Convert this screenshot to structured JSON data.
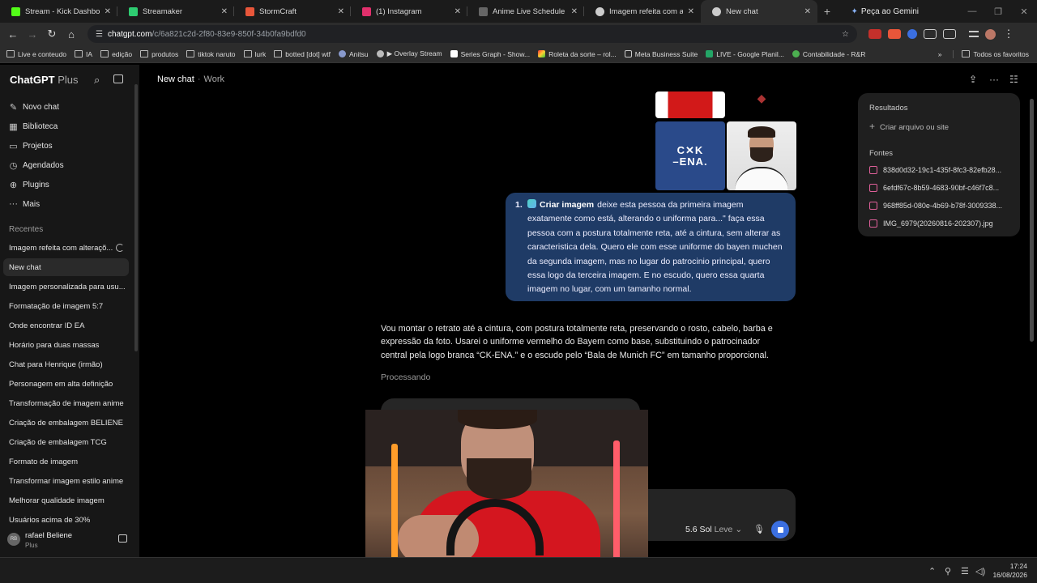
{
  "browser": {
    "tabs": [
      {
        "label": "Stream - Kick Dashboard",
        "color": "#53fc18"
      },
      {
        "label": "Streamaker",
        "color": "#2ecc71"
      },
      {
        "label": "StormCraft",
        "color": "#e8563a"
      },
      {
        "label": "(1) Instagram",
        "color": "#e1306c"
      },
      {
        "label": "Anime Live Schedule",
        "color": "#666666"
      },
      {
        "label": "Imagem refeita com alteraç",
        "color": "#cccccc"
      },
      {
        "label": "New chat",
        "color": "#cccccc"
      }
    ],
    "gemini_label": "Peça ao Gemini",
    "url_domain": "chatgpt.com",
    "url_path": "/c/6a821c2d-2f80-83e9-850f-34b0fa9bdfd0",
    "bookmarks": [
      "Live e conteudo",
      "IA",
      "edição",
      "produtos",
      "tiktok naruto",
      "lurk",
      "botted [dot] wtf",
      "Anitsu",
      "▶ Overlay Stream",
      "Series Graph - Show...",
      "Roleta da sorte – rol...",
      "Meta Business Suite",
      "LIVE - Google Planil...",
      "Contabilidade - R&R"
    ],
    "bookmarks_all": "Todos os favoritos"
  },
  "sidebar": {
    "brand": "ChatGPT",
    "plan_suffix": "Plus",
    "nav": [
      {
        "label": "Novo chat",
        "icon": "✎"
      },
      {
        "label": "Biblioteca",
        "icon": "▦"
      },
      {
        "label": "Projetos",
        "icon": "▭"
      },
      {
        "label": "Agendados",
        "icon": "◷"
      },
      {
        "label": "Plugins",
        "icon": "⊕"
      },
      {
        "label": "Mais",
        "icon": "···"
      }
    ],
    "recent_title": "Recentes",
    "chats": [
      "Imagem refeita com alteraçõ...",
      "New chat",
      "Imagem personalizada para usu...",
      "Formatação de imagem 5:7",
      "Onde encontrar ID EA",
      "Horário para duas massas",
      "Chat para Henrique (irmão)",
      "Personagem em alta definição",
      "Transformação de imagem anime",
      "Criação de embalagem BELIENE",
      "Criação de embalagem TCG",
      "Formato de imagem",
      "Transformar imagem estilo anime",
      "Melhorar qualidade imagem",
      "Usuários acima de 30%"
    ],
    "user_name": "rafael Beliene",
    "user_plan": "Plus",
    "user_initials": "RB"
  },
  "header": {
    "title": "New chat",
    "project": "Work"
  },
  "thumbnails": {
    "logo_text_top": "C✕K",
    "logo_text_bottom": "–ENA."
  },
  "prompt": {
    "number": "1.",
    "tool": "Criar imagem",
    "text": "deixe esta pessoa da primeira imagem exatamente como está, alterando o uniforma para...\" faça essa pessoa com a postura totalmente reta, até a cintura, sem alterar as caracteristica dela. Quero ele com esse uniforme do bayen muchen da segunda imagem, mas no lugar do patrocinio principal, quero essa logo da terceira imagem. E no escudo, quero essa quarta imagem no lugar, com um tamanho normal."
  },
  "reply": {
    "text": "Vou montar o retrato até a cintura, com postura totalmente reta, preservando o rosto, cabelo, barba e expressão da foto. Usarei o uniforme vermelho do Bayern como base, substituindo o patrocinador central pela logo branca “CK-ENA.” e o escudo pelo “Bala de Munich FC” em tamanho proporcional.",
    "status": "Processando"
  },
  "composer": {
    "model": "5.6 Sol",
    "mode": "Leve"
  },
  "panel": {
    "results_title": "Resultados",
    "create_label": "Criar arquivo ou site",
    "sources_title": "Fontes",
    "sources": [
      "838d0d32-19c1-435f-8fc3-82efb28...",
      "6efdf67c-8b59-4683-90bf-c46f7c8...",
      "968ff85d-080e-4b69-b78f-3009338...",
      "IMG_6979(20260816-202307).jpg"
    ]
  },
  "taskbar": {
    "time": "17:24",
    "date": "16/08/2026"
  }
}
